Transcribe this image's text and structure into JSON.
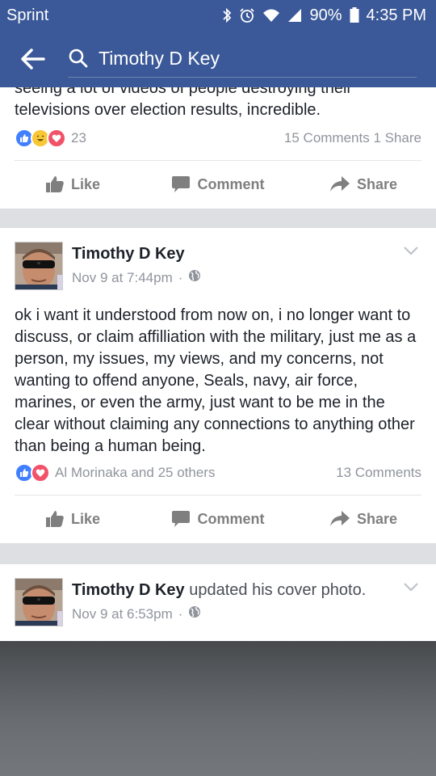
{
  "status_bar": {
    "carrier": "Sprint",
    "battery": "90%",
    "time": "4:35 PM"
  },
  "search": {
    "query": "Timothy D Key"
  },
  "posts": [
    {
      "text": "seeing a lot of videos of people destroying their televisions over election results, incredible.",
      "reaction_count": "23",
      "comments_shares": "15 Comments 1 Share"
    },
    {
      "author": "Timothy D Key",
      "time": "Nov 9 at 7:44pm",
      "text": "ok i want it understood from now on, i no longer want to discuss, or claim affilliation with the military, just me as a person, my issues, my views, and my concerns, not wanting to offend anyone, Seals, navy, air force, marines, or even the army, just want to be me in the clear without claiming any connections to anything other than being a human being.",
      "reactions_by": "Al Morinaka and 25 others",
      "comments": "13 Comments"
    },
    {
      "author": "Timothy D Key",
      "action": "updated his cover photo.",
      "time": "Nov 9 at 6:53pm"
    }
  ],
  "actions": {
    "like": "Like",
    "comment": "Comment",
    "share": "Share"
  },
  "icons": {
    "back": "back-arrow-icon",
    "search": "search-icon",
    "privacy": "globe-icon",
    "menu": "chevron-down-icon"
  },
  "colors": {
    "brand": "#3b5998",
    "like": "#4080ff",
    "love": "#f25268",
    "haha": "#f7c737"
  }
}
